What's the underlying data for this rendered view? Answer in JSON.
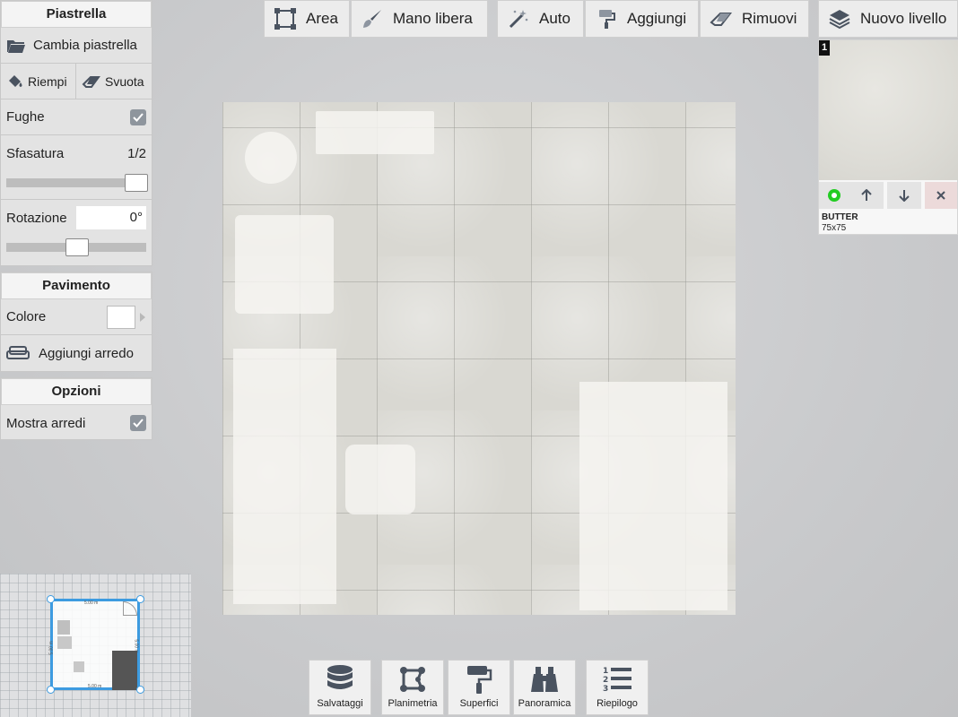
{
  "left_panel": {
    "tile_section": {
      "title": "Piastrella",
      "change_tile_label": "Cambia piastrella",
      "fill_label": "Riempi",
      "clear_label": "Svuota",
      "grout_label": "Fughe",
      "grout_checked": true,
      "offset_label": "Sfasatura",
      "offset_value": "1/2",
      "offset_level": 1.0,
      "rotation_label": "Rotazione",
      "rotation_value": "0°",
      "rotation_level": 0.5
    },
    "floor_section": {
      "title": "Pavimento",
      "color_label": "Colore",
      "color_value": "#ffffff",
      "add_furniture_label": "Aggiungi arredo"
    },
    "options_section": {
      "title": "Opzioni",
      "show_furniture_label": "Mostra arredi",
      "show_furniture_checked": true
    }
  },
  "toolbar": {
    "area_label": "Area",
    "freehand_label": "Mano libera",
    "auto_label": "Auto",
    "add_label": "Aggiungi",
    "remove_label": "Rimuovi",
    "new_level_label": "Nuovo livello"
  },
  "level_panel": {
    "badge": "1",
    "tile_name": "BUTTER",
    "tile_size": "75x75",
    "active_color": "#22cc22"
  },
  "minimap": {
    "top_dim": "5.00 m",
    "bottom_dim": "5.00 m",
    "left_dim": "5.00 m",
    "right_dim": "5.00 m",
    "accent": "#3d9be0"
  },
  "bottom_nav": {
    "saves_label": "Salvataggi",
    "floorplan_label": "Planimetria",
    "surfaces_label": "Superfici",
    "overview_label": "Panoramica",
    "summary_label": "Riepilogo"
  },
  "colors": {
    "icon": "#4a5360",
    "panel_bg": "#e3e3e3",
    "toolbar_bg": "#ececec"
  }
}
